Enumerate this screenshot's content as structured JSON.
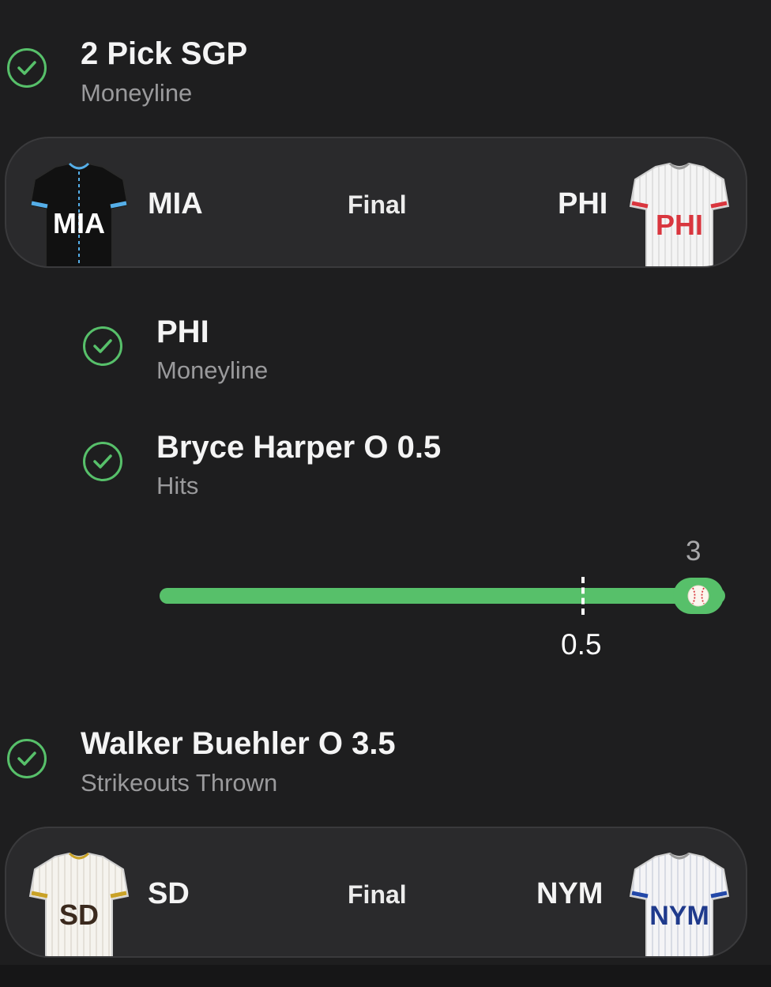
{
  "parlay": {
    "title": "2 Pick SGP",
    "subtitle": "Moneyline"
  },
  "game1": {
    "away_team": "MIA",
    "home_team": "PHI",
    "status": "Final",
    "away_jersey_text": "MIA",
    "home_jersey_text": "PHI"
  },
  "legs": [
    {
      "title": "PHI",
      "subtitle": "Moneyline"
    },
    {
      "title": "Bryce Harper O 0.5",
      "subtitle": "Hits"
    }
  ],
  "progress": {
    "line": 0.5,
    "current": 3,
    "line_label": "0.5",
    "current_label": "3",
    "fill_fraction": 1.0,
    "color": "#57c06a"
  },
  "pick2": {
    "title": "Walker Buehler O 3.5",
    "subtitle": "Strikeouts Thrown"
  },
  "game2": {
    "away_team": "SD",
    "home_team": "NYM",
    "status": "Final",
    "away_jersey_text": "SD",
    "home_jersey_text": "NYM"
  },
  "icons": {
    "check": "check-circle-icon",
    "baseball": "baseball-icon"
  },
  "colors": {
    "success": "#57c06a",
    "background": "#1e1e1f",
    "card": "#2a2a2c"
  }
}
